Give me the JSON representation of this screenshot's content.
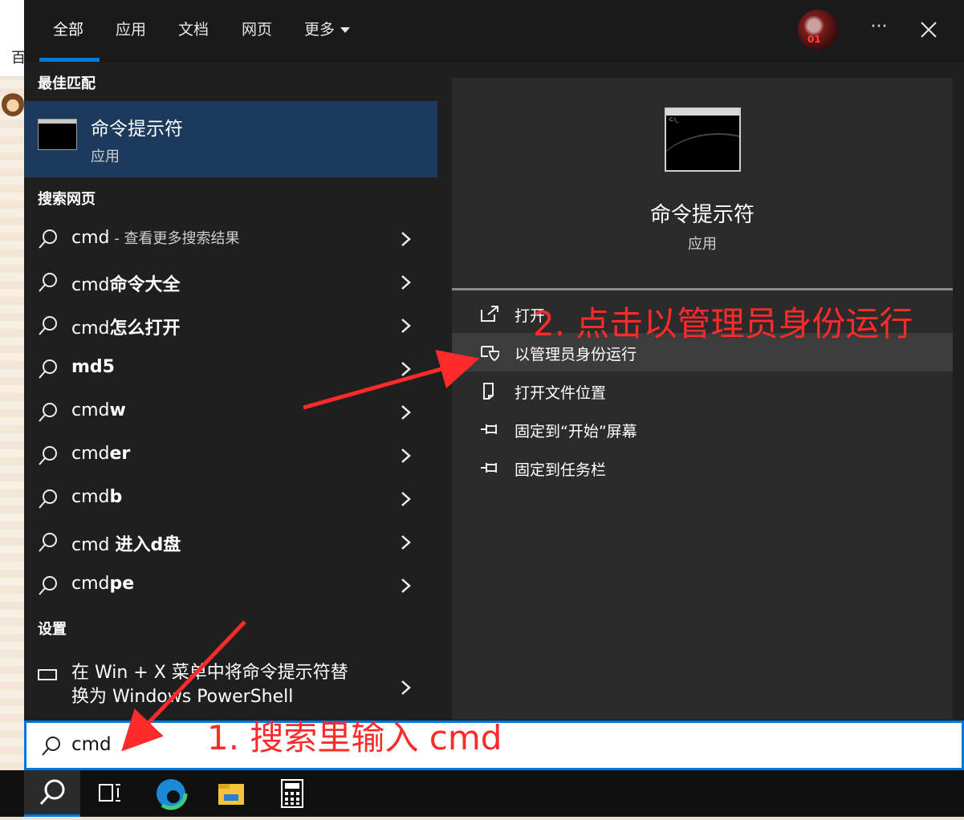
{
  "background": {
    "left_edge_char": "百"
  },
  "tabs": [
    {
      "label": "全部",
      "active": true
    },
    {
      "label": "应用"
    },
    {
      "label": "文档"
    },
    {
      "label": "网页"
    },
    {
      "label": "更多"
    }
  ],
  "header": {
    "avatar_text": "01",
    "more_glyph": "···"
  },
  "best_match": {
    "heading": "最佳匹配",
    "title": "命令提示符",
    "subtitle": "应用"
  },
  "web": {
    "heading": "搜索网页",
    "items": [
      {
        "pre": "cmd",
        "bold": "",
        "hint": " - 查看更多搜索结果"
      },
      {
        "pre": "cmd",
        "bold": "命令大全",
        "hint": ""
      },
      {
        "pre": "cmd",
        "bold": "怎么打开",
        "hint": ""
      },
      {
        "pre": "",
        "bold": "md5",
        "hint": ""
      },
      {
        "pre": "cmd",
        "bold": "w",
        "hint": ""
      },
      {
        "pre": "cmd",
        "bold": "er",
        "hint": ""
      },
      {
        "pre": "cmd",
        "bold": "b",
        "hint": ""
      },
      {
        "pre": "cmd ",
        "bold": "进入d盘",
        "hint": ""
      },
      {
        "pre": "cmd",
        "bold": "pe",
        "hint": ""
      }
    ]
  },
  "settings": {
    "heading": "设置",
    "line1": "在 Win + X 菜单中将命令提示符替",
    "line2": "换为 Windows PowerShell"
  },
  "preview": {
    "thumb_prompt": "C:\\_",
    "title": "命令提示符",
    "subtitle": "应用",
    "actions": [
      {
        "label": "打开",
        "icon": "open-external-icon"
      },
      {
        "label": "以管理员身份运行",
        "icon": "shield-icon",
        "highlighted": true
      },
      {
        "label": "打开文件位置",
        "icon": "file-location-icon"
      },
      {
        "label": "固定到“开始”屏幕",
        "icon": "pin-icon"
      },
      {
        "label": "固定到任务栏",
        "icon": "pin-icon"
      }
    ]
  },
  "search": {
    "value": "cmd"
  },
  "annotations": {
    "step1": "1. 搜索里输入 cmd",
    "step2": "2. 点击以管理员身份运行"
  },
  "colors": {
    "accent": "#0078d7",
    "selected": "#1b3a5c",
    "annotation": "#ff2a2a"
  }
}
